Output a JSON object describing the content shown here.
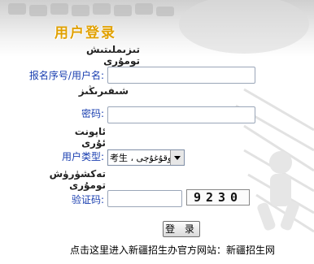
{
  "header": {
    "title": "用户登录",
    "title_uyghur": "تىزىملىتىش تومۇرى"
  },
  "form": {
    "username": {
      "label": "报名序号/用户名:",
      "label_uyghur": "شىفىرىڭىز",
      "value": ""
    },
    "password": {
      "label": "密码:",
      "label_uyghur": "ئاپونت ئۇرى",
      "value": ""
    },
    "user_type": {
      "label": "用户类型:",
      "label_uyghur": "تەكشۈرۈش تومۇرى",
      "selected": "考生 ، ئوقۇغۇچى"
    },
    "captcha": {
      "label": "验证码:",
      "value": "",
      "code": "9230"
    },
    "submit_label": "登 录"
  },
  "footer": {
    "text": "点击这里进入新疆招生办官方网站：",
    "link_text": "新疆招生网"
  },
  "colors": {
    "title": "#e0a000",
    "label": "#1a3fb0"
  }
}
